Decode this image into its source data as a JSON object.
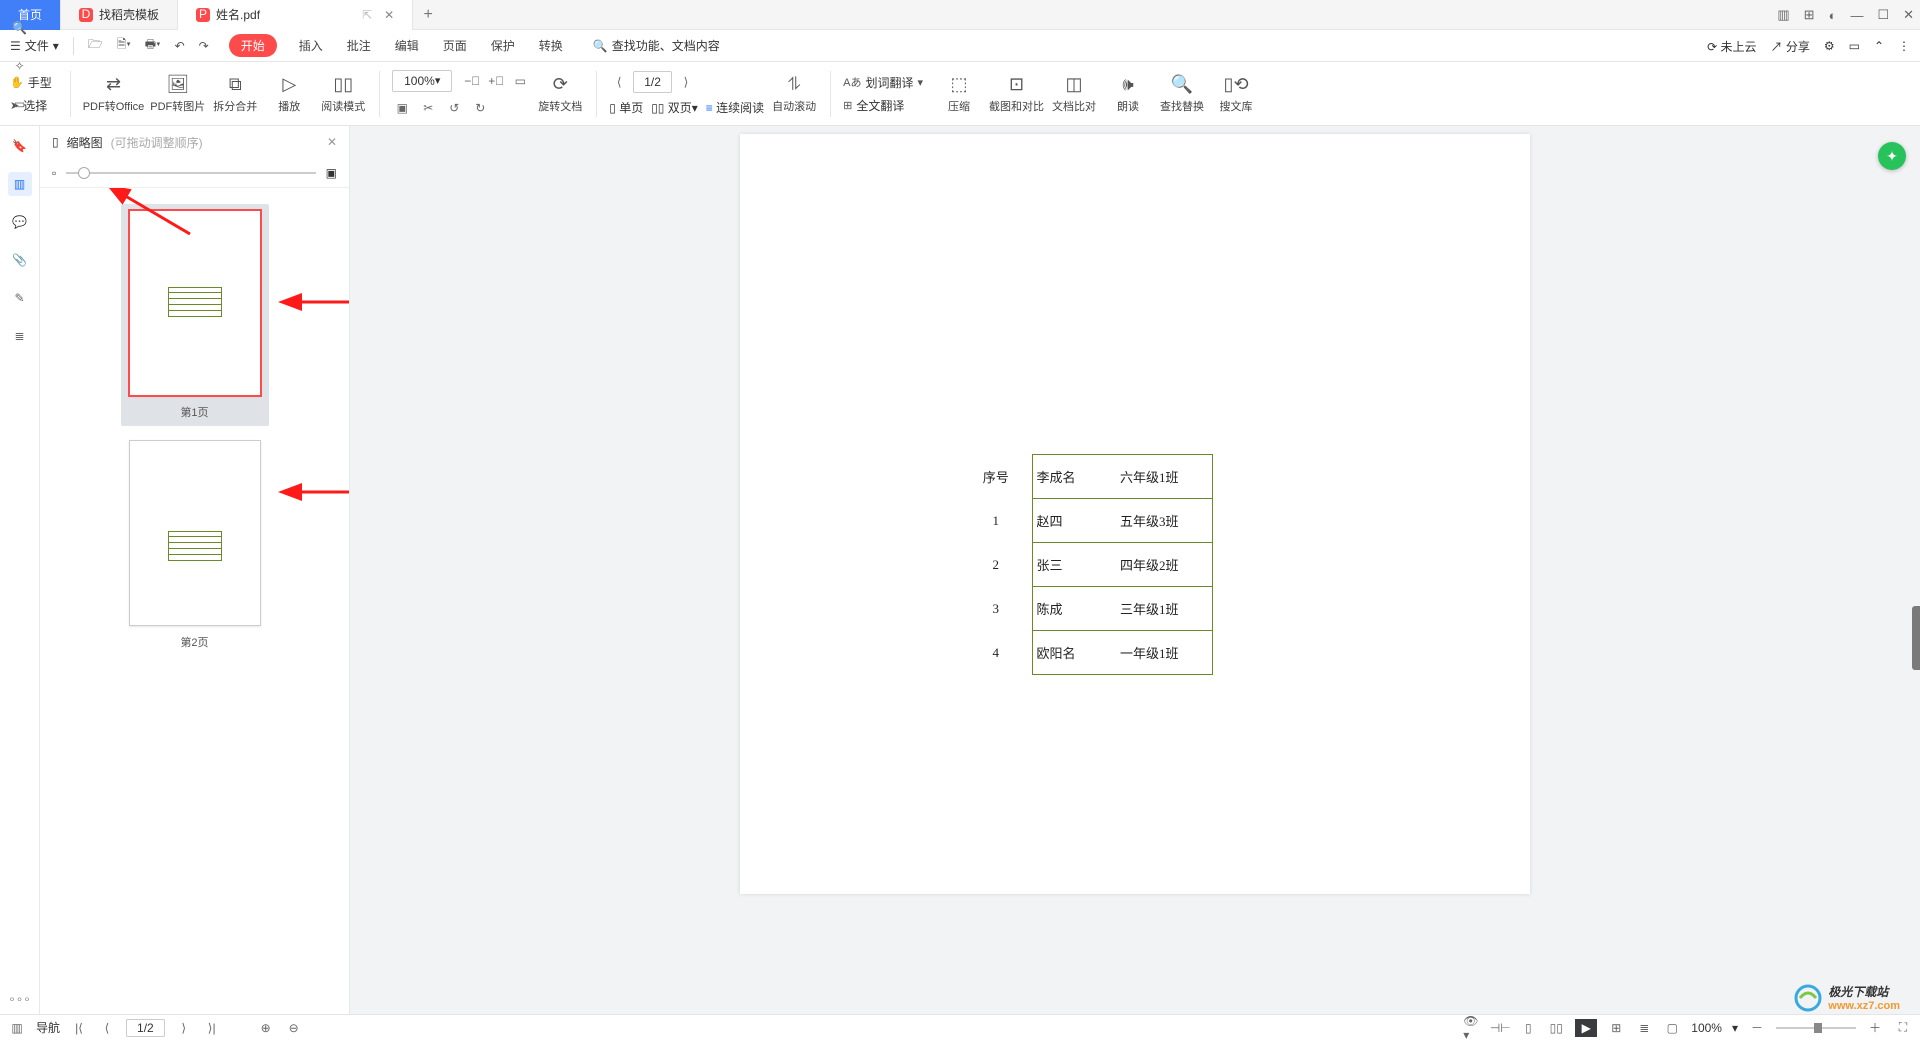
{
  "tabs": {
    "home": "首页",
    "t1": "找稻壳模板",
    "t2": "姓名.pdf",
    "plus": "+"
  },
  "file_label": "文件",
  "menus": {
    "start": "开始",
    "insert": "插入",
    "annotate": "批注",
    "edit": "编辑",
    "page": "页面",
    "protect": "保护",
    "convert": "转换"
  },
  "search_ph": "查找功能、文档内容",
  "top_right": {
    "cloud": "未上云",
    "share": "分享"
  },
  "ribbon": {
    "hand": "手型",
    "select": "选择",
    "pdf_office": "PDF转Office",
    "pdf_img": "PDF转图片",
    "split": "拆分合并",
    "play": "播放",
    "read": "阅读模式",
    "zoom": "100%",
    "page_ind": "1/2",
    "rotate": "旋转文档",
    "single": "单页",
    "dual": "双页",
    "cont": "连续阅读",
    "autoroll": "自动滚动",
    "word_trans": "划词翻译",
    "full_trans": "全文翻译",
    "compress": "压缩",
    "crop": "截图和对比",
    "compare": "文档比对",
    "tts": "朗读",
    "findrep": "查找替换",
    "lib": "搜文库"
  },
  "thumb": {
    "title": "缩略图",
    "hint": "(可拖动调整顺序)",
    "p1": "第1页",
    "p2": "第2页"
  },
  "table": {
    "header": {
      "seq": "序号",
      "name": "李成名",
      "cls": "六年级1班"
    },
    "rows": [
      {
        "seq": "1",
        "name": "赵四",
        "cls": "五年级3班"
      },
      {
        "seq": "2",
        "name": "张三",
        "cls": "四年级2班"
      },
      {
        "seq": "3",
        "name": "陈成",
        "cls": "三年级1班"
      },
      {
        "seq": "4",
        "name": "欧阳名",
        "cls": "一年级1班"
      }
    ]
  },
  "status": {
    "nav": "导航",
    "page": "1/2",
    "zoom": "100%"
  },
  "watermark": {
    "brand": "极光下载站",
    "url": "www.xz7.com"
  }
}
